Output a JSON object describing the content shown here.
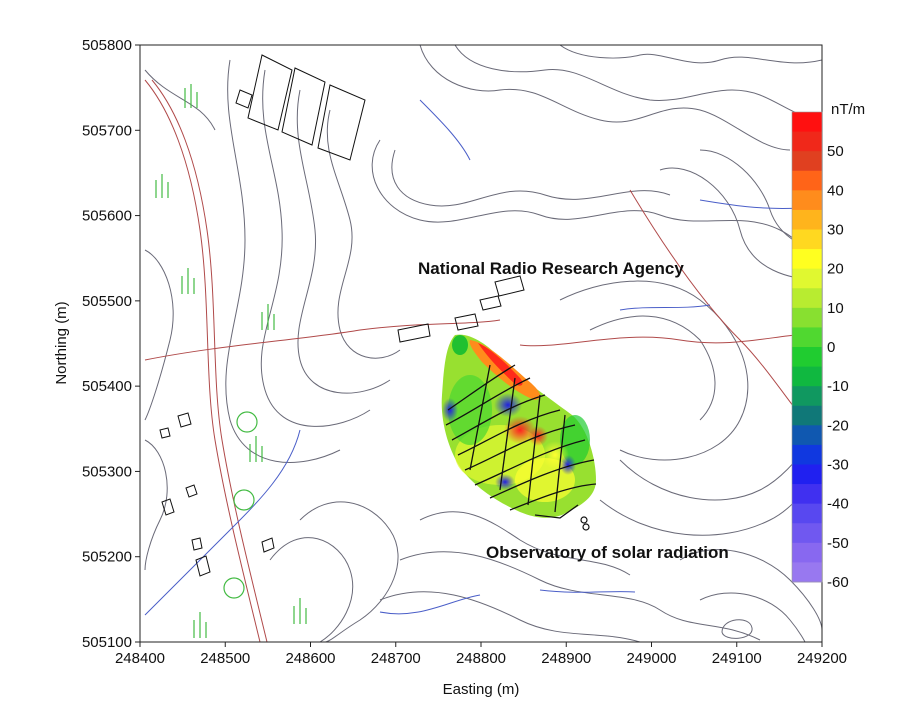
{
  "map": {
    "x_axis": {
      "title": "Easting (m)",
      "ticks": [
        "248400",
        "248500",
        "248600",
        "248700",
        "248800",
        "248900",
        "249000",
        "249100",
        "249200"
      ]
    },
    "y_axis": {
      "title": "Northing (m)",
      "ticks": [
        "505100",
        "505200",
        "505300",
        "505400",
        "505500",
        "505600",
        "505700",
        "505800"
      ]
    },
    "annotations": {
      "agency": "National Radio Research Agency",
      "observatory": "Observatory of solar radiation"
    },
    "colorbar": {
      "unit": "nT/m",
      "labels": [
        "50",
        "40",
        "30",
        "20",
        "10",
        "0",
        "-10",
        "-20",
        "-30",
        "-40",
        "-50",
        "-60"
      ],
      "colors": [
        "#ff1010",
        "#f0281a",
        "#e04020",
        "#ff6418",
        "#ff8c1c",
        "#ffb41c",
        "#ffd820",
        "#ffff20",
        "#e0f830",
        "#b8ec30",
        "#88e030",
        "#50d830",
        "#20cc30",
        "#10b840",
        "#109860",
        "#107878",
        "#1058b0",
        "#1038e0",
        "#2020f0",
        "#4030f0",
        "#5848f0",
        "#7058f0",
        "#8868f0",
        "#9878f0"
      ]
    },
    "colors": {
      "contour_gray": "#6a6a78",
      "road_red": "#b04a4a",
      "stream_blue": "#4a5ec8",
      "tree_green": "#44bb44",
      "building": "#111111"
    }
  }
}
